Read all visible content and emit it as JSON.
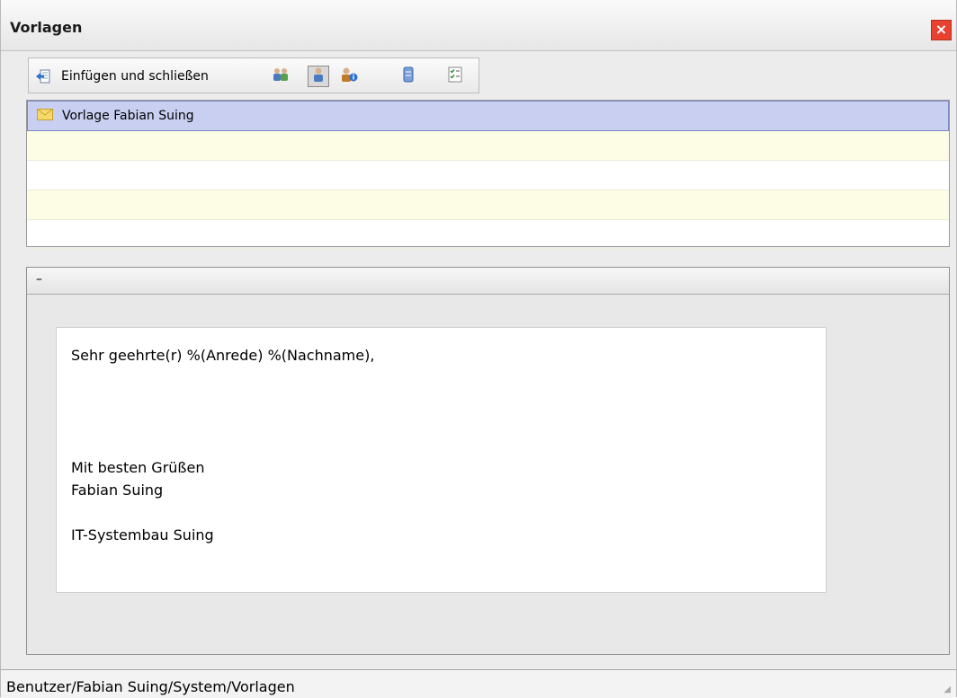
{
  "window": {
    "title": "Vorlagen",
    "close_label": "×"
  },
  "toolbar": {
    "insert_close_label": "Einfügen und schließen",
    "buttons": [
      {
        "icon": "users-icon",
        "active": false
      },
      {
        "icon": "user-icon",
        "active": true
      },
      {
        "icon": "user-info-icon",
        "active": false
      },
      {
        "icon": "database-icon",
        "active": false
      },
      {
        "icon": "checklist-icon",
        "active": false
      }
    ]
  },
  "templates": {
    "items": [
      {
        "label": "Vorlage Fabian Suing",
        "icon": "envelope-icon",
        "selected": true
      }
    ]
  },
  "preview": {
    "collapse_label": "–",
    "greeting": "Sehr geehrte(r) %(Anrede) %(Nachname),",
    "closing": "Mit besten Grüßen",
    "name": "Fabian Suing",
    "company": "IT-Systembau Suing"
  },
  "status": {
    "path": "Benutzer/Fabian Suing/System/Vorlagen"
  }
}
